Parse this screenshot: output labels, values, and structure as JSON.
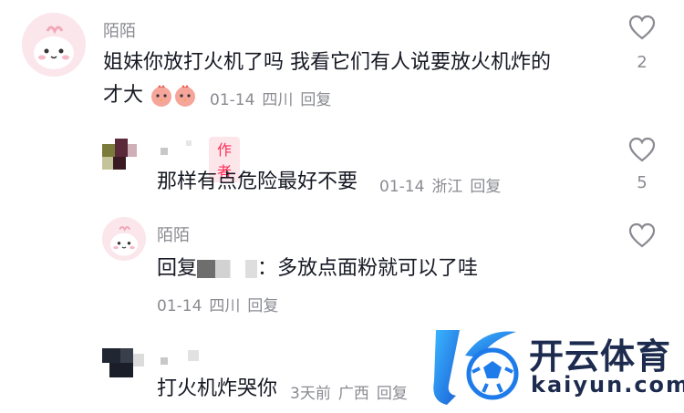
{
  "comments": [
    {
      "name": "陌陌",
      "text_line1": "姐妹你放打火机了吗 我看它们有人说要放火机炸的",
      "text_line2": "才大",
      "date": "01-14",
      "location": "四川",
      "reply_label": "回复",
      "like_count": "2",
      "emojis": [
        "chicken-emoji",
        "chicken-emoji"
      ]
    },
    {
      "author_badge": "作者",
      "text": "那样有点危险最好不要",
      "date": "01-14",
      "location": "浙江",
      "reply_label": "回复",
      "like_count": "5"
    },
    {
      "name": "陌陌",
      "text_prefix": "回复",
      "text_suffix": "：多放点面粉就可以了哇",
      "date": "01-14",
      "location": "四川",
      "reply_label": "回复"
    },
    {
      "text": "打火机炸哭你",
      "time": "3天前",
      "location": "广西",
      "reply_label": "回复"
    }
  ],
  "watermark": {
    "cn": "开云体育",
    "en": "kaiyun.com"
  },
  "colors": {
    "text": "#161823",
    "meta": "#8a8b91",
    "author_badge": "#fe2c55",
    "logo_blue": "#1e7bea"
  }
}
